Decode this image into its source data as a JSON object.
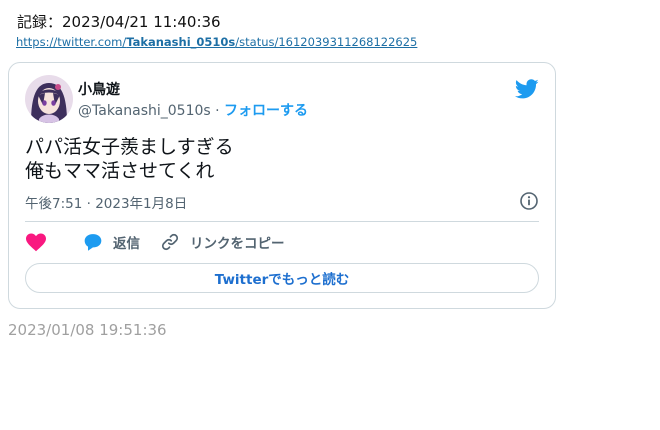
{
  "record": {
    "label": "記録：2023/04/21 11:40:36"
  },
  "url": {
    "prefix": "https://twitter.com/",
    "user": "Takanashi_0510s",
    "suffix": "/status/1612039311268122625"
  },
  "tweet": {
    "display_name": "小鳥遊",
    "handle": "@Takanashi_0510s",
    "separator": " · ",
    "follow_label": "フォローする",
    "text_line1": "パパ活女子羨ましすぎる",
    "text_line2": "俺もママ活させてくれ",
    "timestamp": "午後7:51 · 2023年1月8日",
    "reply_label": "返信",
    "copy_link_label": "リンクをコピー",
    "read_more_label": "Twitterでもっと読む",
    "icons": {
      "brand": "twitter-bird-icon",
      "info": "info-icon",
      "like": "heart-icon",
      "reply": "speech-bubble-icon",
      "copy": "link-icon"
    },
    "colors": {
      "brand": "#1d9bf0",
      "like": "#f91880",
      "link": "#1d6fa5"
    }
  },
  "footer": {
    "timestamp": "2023/01/08 19:51:36"
  }
}
